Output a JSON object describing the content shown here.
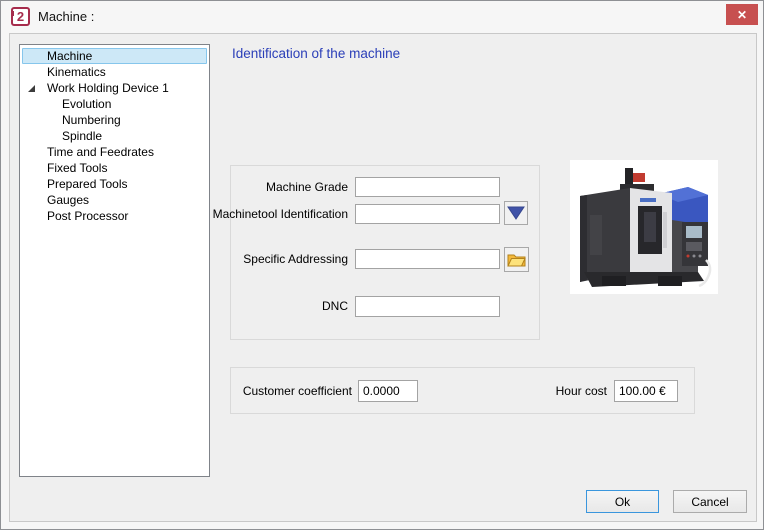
{
  "window": {
    "title": "Machine :",
    "icon_text": "2",
    "close_glyph": "✕"
  },
  "tree": {
    "items": [
      {
        "label": "Machine",
        "level": 1,
        "selected": true
      },
      {
        "label": "Kinematics",
        "level": 1
      },
      {
        "label": "Work Holding Device 1",
        "level": 1,
        "expanded": true
      },
      {
        "label": "Evolution",
        "level": 2
      },
      {
        "label": "Numbering",
        "level": 2
      },
      {
        "label": "Spindle",
        "level": 2
      },
      {
        "label": "Time and Feedrates",
        "level": 1
      },
      {
        "label": "Fixed Tools",
        "level": 1
      },
      {
        "label": "Prepared Tools",
        "level": 1
      },
      {
        "label": "Gauges",
        "level": 1
      },
      {
        "label": "Post Processor",
        "level": 1
      }
    ]
  },
  "main": {
    "heading": "Identification of the machine",
    "identification": {
      "machine_grade_label": "Machine Grade",
      "machine_grade_value": "",
      "machinetool_identification_label": "Machinetool Identification",
      "machinetool_identification_value": "",
      "specific_addressing_label": "Specific Addressing",
      "specific_addressing_value": "",
      "dnc_label": "DNC",
      "dnc_value": ""
    },
    "cost": {
      "customer_coefficient_label": "Customer coefficient",
      "customer_coefficient_value": "0.0000",
      "hour_cost_label": "Hour cost",
      "hour_cost_value": "100.00 €"
    }
  },
  "footer": {
    "ok_label": "Ok",
    "cancel_label": "Cancel"
  },
  "colors": {
    "close_button": "#c75050",
    "selection_bg": "#cde8f7",
    "selection_border": "#86c6ec",
    "heading_blue": "#2a3eb8",
    "dropdown_triangle": "#4053a8",
    "folder_yellow": "#f7c843"
  }
}
